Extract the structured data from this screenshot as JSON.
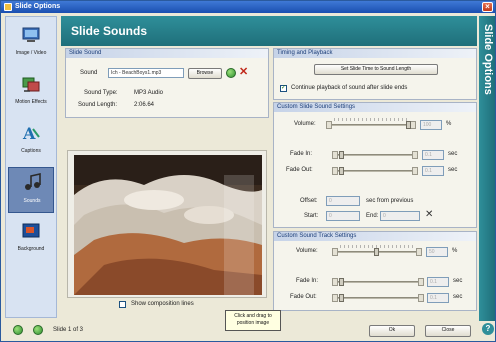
{
  "window": {
    "title": "Slide Options"
  },
  "header": {
    "title": "Slide Sounds"
  },
  "banner": {
    "text": "Slide Options"
  },
  "sidebar": {
    "items": [
      {
        "label": "Image / Video",
        "icon": "image-video-icon"
      },
      {
        "label": "Motion Effects",
        "icon": "motion-effects-icon"
      },
      {
        "label": "Captions",
        "icon": "captions-icon"
      },
      {
        "label": "Sounds",
        "icon": "sounds-icon",
        "active": true
      },
      {
        "label": "Background",
        "icon": "background-icon"
      }
    ]
  },
  "slide_sound": {
    "heading": "Slide Sound",
    "sound_label": "Sound",
    "sound_value": "Ich - BeachBoys1.mp3",
    "browse_label": "Browse",
    "type_label": "Sound Type:",
    "type_value": "MP3 Audio",
    "length_label": "Sound Length:",
    "length_value": "2:06.64"
  },
  "timing": {
    "heading": "Timing and Playback",
    "set_button": "Set Slide Time to Sound Length",
    "continue_label": "Continue playback of sound after slide ends",
    "continue_checked": true
  },
  "custom_slide": {
    "heading": "Custom Slide Sound Settings",
    "volume_label": "Volume:",
    "volume_value": "100",
    "volume_unit": "%",
    "fade_in_label": "Fade In:",
    "fade_in_value": "0.1",
    "fade_out_label": "Fade Out:",
    "fade_out_value": "0.1",
    "sec_unit": "sec",
    "offset_label": "Offset:",
    "offset_value": "0",
    "offset_suffix": "sec from previous",
    "start_label": "Start:",
    "start_value": "0",
    "end_label": "End:",
    "end_value": "0"
  },
  "custom_track": {
    "heading": "Custom Sound Track Settings",
    "volume_label": "Volume:",
    "volume_value": "50",
    "volume_unit": "%",
    "fade_in_label": "Fade In:",
    "fade_in_value": "0.1",
    "fade_out_label": "Fade Out:",
    "fade_out_value": "0.1",
    "sec_unit": "sec"
  },
  "preview": {
    "show_lines_label": "Show composition lines"
  },
  "tooltip": {
    "text": "Click and drag to position image"
  },
  "status": {
    "slide_text": "Slide 1 of 3"
  },
  "buttons": {
    "ok": "Ok",
    "close": "Close"
  },
  "colors": {
    "accent": "#2f8f9a",
    "title_bar": "#1a4fb0"
  }
}
